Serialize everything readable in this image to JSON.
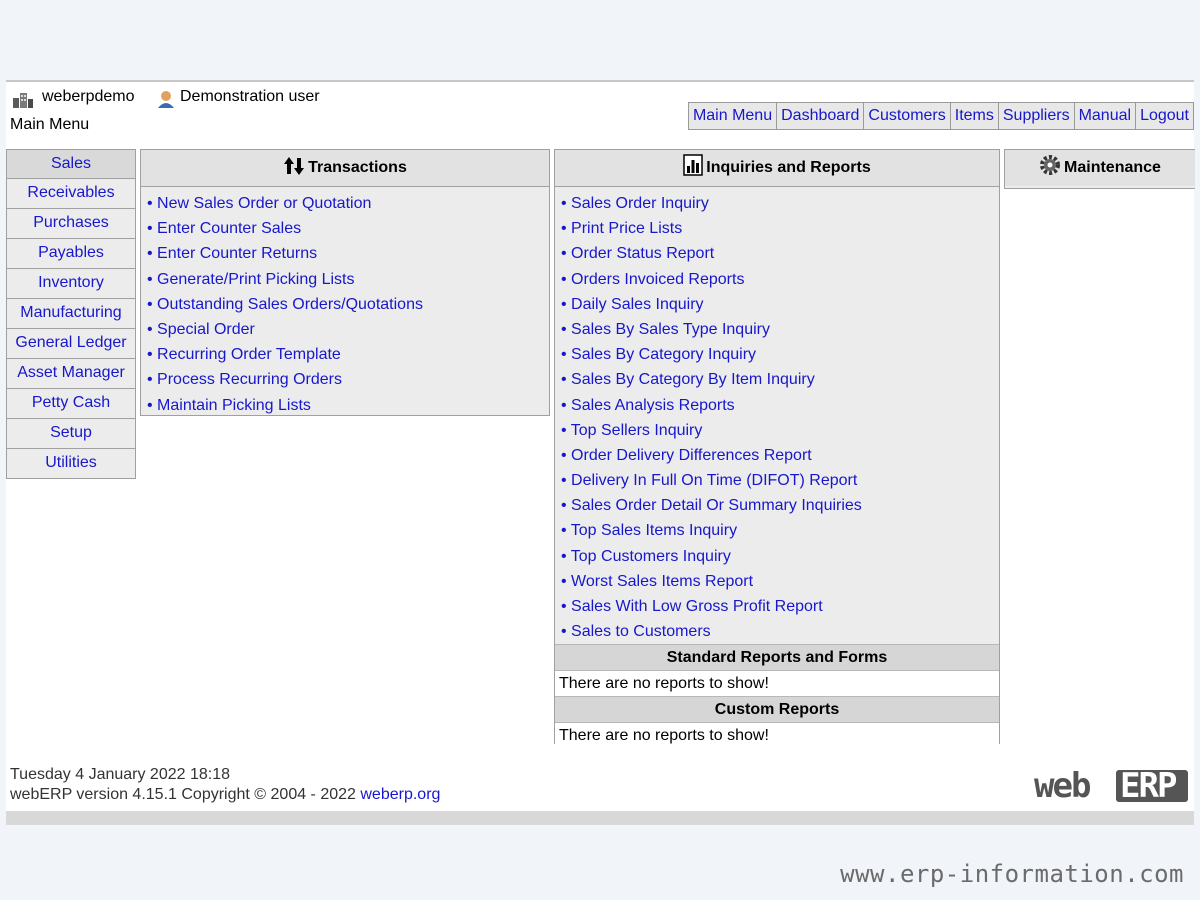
{
  "header": {
    "company": "weberpdemo",
    "user": "Demonstration user",
    "page_title": "Main Menu"
  },
  "topnav": [
    "Main Menu",
    "Dashboard",
    "Customers",
    "Items",
    "Suppliers",
    "Manual",
    "Logout"
  ],
  "sidebar": {
    "active": "Sales",
    "items": [
      "Sales",
      "Receivables",
      "Purchases",
      "Payables",
      "Inventory",
      "Manufacturing",
      "General Ledger",
      "Asset Manager",
      "Petty Cash",
      "Setup",
      "Utilities"
    ]
  },
  "transactions": {
    "title": "Transactions",
    "items": [
      "New Sales Order or Quotation",
      "Enter Counter Sales",
      "Enter Counter Returns",
      "Generate/Print Picking Lists",
      "Outstanding Sales Orders/Quotations",
      "Special Order",
      "Recurring Order Template",
      "Process Recurring Orders",
      "Maintain Picking Lists"
    ]
  },
  "inquiries": {
    "title": "Inquiries and Reports",
    "items": [
      "Sales Order Inquiry",
      "Print Price Lists",
      "Order Status Report",
      "Orders Invoiced Reports",
      "Daily Sales Inquiry",
      "Sales By Sales Type Inquiry",
      "Sales By Category Inquiry",
      "Sales By Category By Item Inquiry",
      "Sales Analysis Reports",
      "Top Sellers Inquiry",
      "Order Delivery Differences Report",
      "Delivery In Full On Time (DIFOT) Report",
      "Sales Order Detail Or Summary Inquiries",
      "Top Sales Items Inquiry",
      "Top Customers Inquiry",
      "Worst Sales Items Report",
      "Sales With Low Gross Profit Report",
      "Sales to Customers"
    ],
    "standard_reports_title": "Standard Reports and Forms",
    "standard_reports_empty": "There are no reports to show!",
    "custom_reports_title": "Custom Reports",
    "custom_reports_empty": "There are no reports to show!"
  },
  "maintenance": {
    "title": "Maintenance"
  },
  "footer": {
    "datetime": "Tuesday 4 January 2022 18:18",
    "copyright": "webERP version 4.15.1 Copyright © 2004 - 2022 ",
    "link": "weberp.org",
    "logo_text": "webERP"
  },
  "watermark": "www.erp-information.com",
  "colors": {
    "link": "#1717cc",
    "panel": "#ececec",
    "header": "#e2e2e2"
  }
}
